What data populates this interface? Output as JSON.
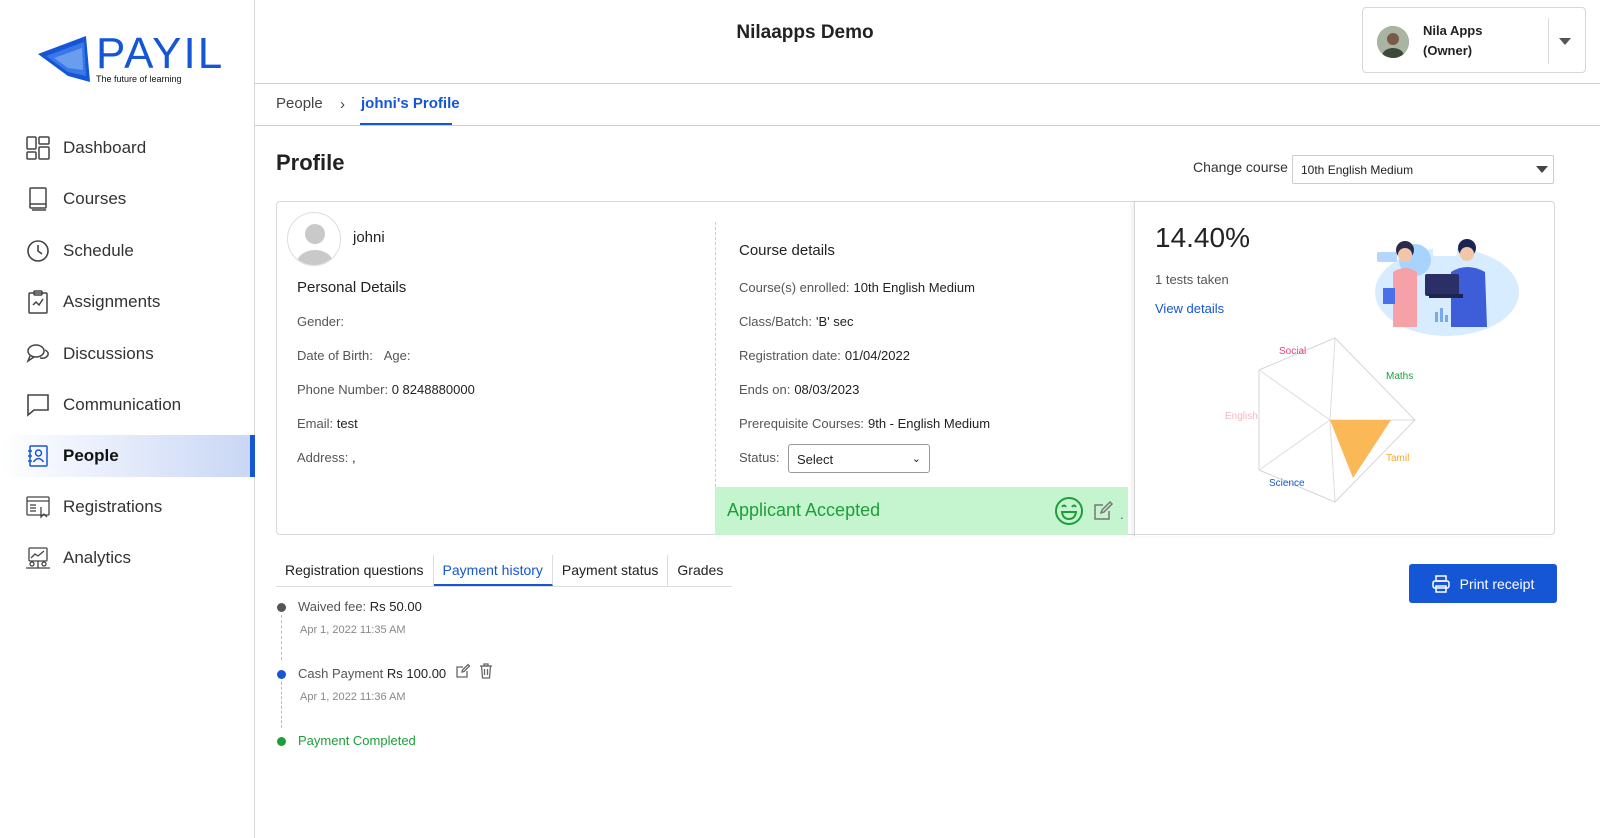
{
  "brand": {
    "name": "PAYIL",
    "tagline": "The future of learning",
    "color": "#1456d6"
  },
  "header": {
    "title": "Nilaapps Demo",
    "user_name": "Nila Apps",
    "user_role": "(Owner)"
  },
  "sidebar": {
    "items": [
      {
        "label": "Dashboard",
        "icon": "dashboard-icon"
      },
      {
        "label": "Courses",
        "icon": "book-icon"
      },
      {
        "label": "Schedule",
        "icon": "clock-icon"
      },
      {
        "label": "Assignments",
        "icon": "clipboard-icon"
      },
      {
        "label": "Discussions",
        "icon": "chat-bubbles-icon"
      },
      {
        "label": "Communication",
        "icon": "message-icon"
      },
      {
        "label": "People",
        "icon": "people-icon",
        "active": true
      },
      {
        "label": "Registrations",
        "icon": "registration-icon"
      },
      {
        "label": "Analytics",
        "icon": "analytics-icon"
      }
    ]
  },
  "breadcrumb": {
    "parent": "People",
    "current": "johni's Profile"
  },
  "profile": {
    "title": "Profile",
    "change_course_label": "Change course",
    "selected_course": "10th English Medium",
    "name": "johni",
    "personal_details_title": "Personal Details",
    "gender_label": "Gender:",
    "dob_label": "Date of Birth:",
    "age_label": "Age:",
    "phone_label": "Phone Number:",
    "phone_value": "0 8248880000",
    "email_label": "Email:",
    "email_value": "test",
    "address_label": "Address:",
    "address_value": ","
  },
  "course_details": {
    "title": "Course details",
    "enrolled_label": "Course(s) enrolled:",
    "enrolled_value": "10th English Medium",
    "batch_label": "Class/Batch:",
    "batch_value": "'B' sec",
    "reg_date_label": "Registration date:",
    "reg_date_value": "01/04/2022",
    "ends_label": "Ends on:",
    "ends_value": "08/03/2023",
    "prereq_label": "Prerequisite Courses:",
    "prereq_value": "9th - English Medium",
    "status_label": "Status:",
    "status_value": "Select",
    "applicant_status": "Applicant Accepted",
    "dot": "."
  },
  "performance": {
    "score": "14.40%",
    "tests_taken": "1 tests taken",
    "view_details": "View details",
    "radar_labels": [
      {
        "label": "Social",
        "color": "#e0457b"
      },
      {
        "label": "Maths",
        "color": "#1e9e3a"
      },
      {
        "label": "Tamil",
        "color": "#f5a623"
      },
      {
        "label": "Science",
        "color": "#1456d6"
      },
      {
        "label": "English",
        "color": "#f0b8c0"
      }
    ],
    "highlight_color": "#fbb857"
  },
  "tabs": [
    "Registration questions",
    "Payment history",
    "Payment status",
    "Grades"
  ],
  "active_tab": "Payment history",
  "print_label": "Print receipt",
  "payments": [
    {
      "label": "Waived fee:",
      "amount": "Rs 50.00",
      "time": "Apr 1, 2022 11:35 AM",
      "color": "#555555"
    },
    {
      "label": "Cash Payment",
      "amount": "Rs 100.00",
      "time": "Apr 1, 2022 11:36 AM",
      "color": "#1456d6"
    }
  ],
  "payment_completed": "Payment Completed",
  "completed_color": "#1e9e3a"
}
